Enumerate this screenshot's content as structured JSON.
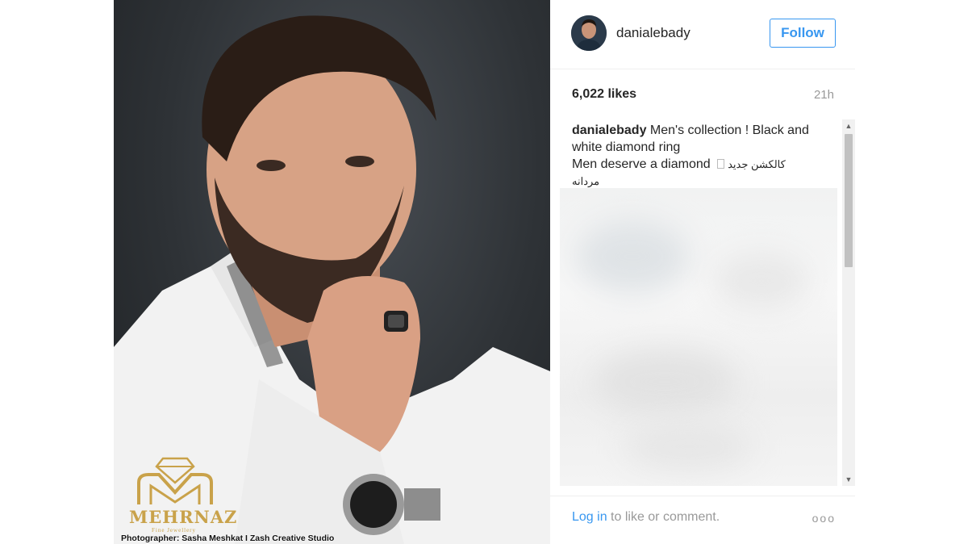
{
  "post": {
    "username": "danialebady",
    "follow_label": "Follow",
    "likes": "6,022 likes",
    "time_ago": "21h",
    "caption": {
      "user": "danialebady",
      "text_line1": " Men's collection ! Black and white diamond ring",
      "text_line2": "Men deserve a diamond ",
      "text_rtl_line1": "کالکشن جدید",
      "text_rtl_line2": "مردانه"
    },
    "login_link": "Log in",
    "login_suffix": " to like or comment.",
    "more_label": "ooo"
  },
  "image_overlay": {
    "brand": "MEHRNAZ",
    "brand_tag": "Fine Jewellery",
    "credit": "Photographer: Sasha Meshkat I Zash Creative Studio"
  },
  "colors": {
    "accent": "#3897f0",
    "gold": "#c9a24a",
    "text": "#262626",
    "muted": "#999999"
  },
  "icons": {
    "scroll_up": "triangle-up",
    "scroll_down": "triangle-down",
    "more": "three-dots"
  }
}
